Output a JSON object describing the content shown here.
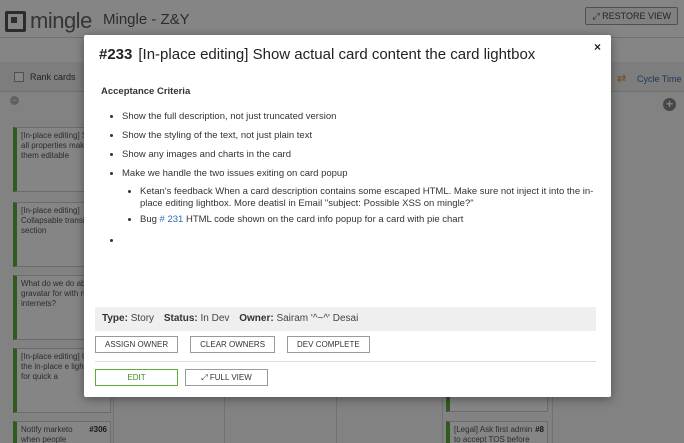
{
  "app": {
    "logo_text": "mingle",
    "project_name": "Mingle - Z&Y",
    "restore_view_label": "RESTORE VIEW"
  },
  "toolbar": {
    "rank_cards_label": "Rank cards",
    "cycle_time_label": "Cycle Time"
  },
  "board_cards": [
    {
      "text": "[In-place editing] Show all properties make them editable",
      "number": ""
    },
    {
      "text": "[In-place editing] Collapsable transit section",
      "number": ""
    },
    {
      "text": "What do we do about gravatar for with no internets?",
      "number": ""
    },
    {
      "text": "[In-place editing] Use the in-place e lightbox for quick a",
      "number": ""
    },
    {
      "text": "Notify marketo when people request",
      "number": "#306"
    },
    {
      "text": "[Legal] Ask first admin to accept TOS before",
      "number": "#8"
    }
  ],
  "lightbox": {
    "card_number": "#233",
    "title": "[In-place editing] Show actual card content the card lightbox",
    "close_label": "×",
    "heading": "Acceptance Criteria",
    "criteria": [
      "Show the full description, not just truncated version",
      "Show the styling of the text, not just plain text",
      "Show any images and charts in the card",
      "Make we handle the two issues exiting on card popup"
    ],
    "sub_criteria": [
      "Ketan's feedback When a card description contains some escaped HTML. Make sure not inject it into the in-place editing lightbox. More deatisl in Email \"subject: Possible XSS on mingle?\""
    ],
    "bug_item": {
      "prefix": "Bug ",
      "link": "# 231",
      "suffix": " HTML code shown on the card info popup for a card with pie chart"
    },
    "properties": {
      "type_label": "Type:",
      "type_value": "Story",
      "status_label": "Status:",
      "status_value": "In Dev",
      "owner_label": "Owner:",
      "owner_value": "Sairam '^~^' Desai"
    },
    "buttons": {
      "assign_owner": "ASSIGN OWNER",
      "clear_owners": "CLEAR OWNERS",
      "dev_complete": "DEV COMPLETE",
      "edit": "EDIT",
      "full_view": "FULL VIEW"
    }
  },
  "colors": {
    "accent_green": "#5aae3c",
    "link_blue": "#2a6fb5",
    "cycle_orange": "#e98b2a"
  }
}
